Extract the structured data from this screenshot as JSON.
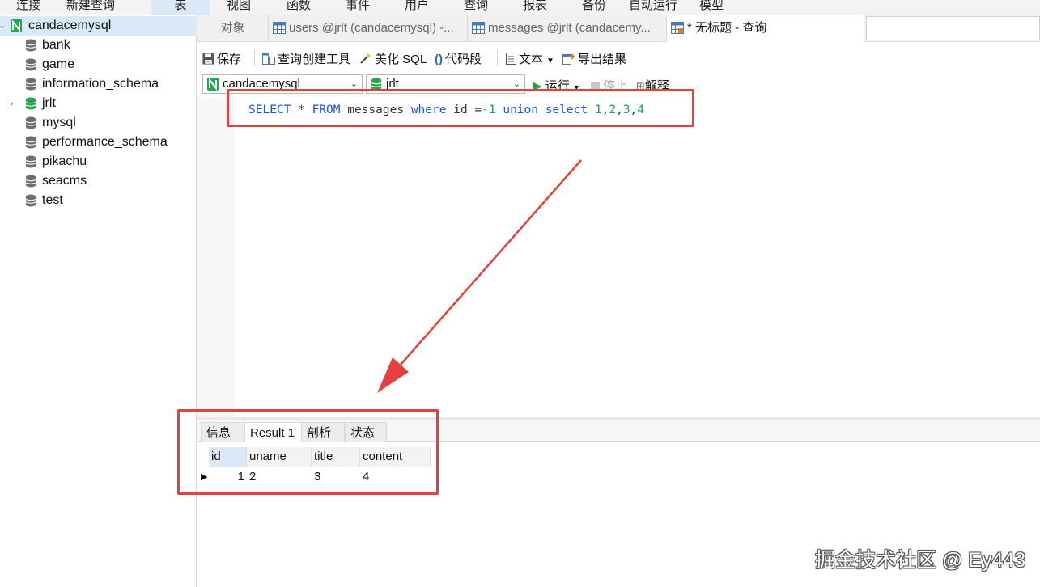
{
  "menu": [
    "连接",
    "新建查询",
    "表",
    "视图",
    "函数",
    "事件",
    "用户",
    "查询",
    "报表",
    "备份",
    "自动运行",
    "模型"
  ],
  "sidebar": {
    "connection": "candacemysql",
    "databases": [
      "bank",
      "game",
      "information_schema",
      "jrlt",
      "mysql",
      "performance_schema",
      "pikachu",
      "seacms",
      "test"
    ]
  },
  "tabs": {
    "objects": "对象",
    "tab1": "users @jrlt (candacemysql) -...",
    "tab2": "messages @jrlt (candacemy...",
    "tab3": "* 无标题 - 查询"
  },
  "toolbar": {
    "save": "保存",
    "query_builder": "查询创建工具",
    "beautify": "美化 SQL",
    "snippet": "代码段",
    "text": "文本",
    "export": "导出结果"
  },
  "selectors": {
    "connection": "candacemysql",
    "database": "jrlt",
    "run": "运行",
    "stop": "停止",
    "explain": "解释"
  },
  "editor": {
    "sql_tokens": [
      {
        "t": "SELECT",
        "c": "kw"
      },
      {
        "t": " * ",
        "c": "plain"
      },
      {
        "t": "FROM",
        "c": "kw"
      },
      {
        "t": " messages ",
        "c": "plain"
      },
      {
        "t": "where",
        "c": "kw"
      },
      {
        "t": " id =",
        "c": "plain"
      },
      {
        "t": "-1",
        "c": "num"
      },
      {
        "t": " ",
        "c": "plain"
      },
      {
        "t": "union",
        "c": "kw"
      },
      {
        "t": " ",
        "c": "plain"
      },
      {
        "t": "select",
        "c": "kw"
      },
      {
        "t": " ",
        "c": "plain"
      },
      {
        "t": "1",
        "c": "num"
      },
      {
        "t": ",",
        "c": "plain"
      },
      {
        "t": "2",
        "c": "num"
      },
      {
        "t": ",",
        "c": "plain"
      },
      {
        "t": "3",
        "c": "num"
      },
      {
        "t": ",",
        "c": "plain"
      },
      {
        "t": "4",
        "c": "num"
      }
    ]
  },
  "results": {
    "tabs": [
      "信息",
      "Result 1",
      "剖析",
      "状态"
    ],
    "columns": [
      "id",
      "uname",
      "title",
      "content"
    ],
    "rows": [
      [
        "1",
        "2",
        "3",
        "4"
      ]
    ]
  },
  "watermark": "掘金技术社区 @ Ey443",
  "colors": {
    "annotation": "#e34040",
    "keyword": "#1a4ff5",
    "number": "#1aa15a",
    "db_icon_green": "#1fa84f",
    "db_icon_gray": "#6f6f6f"
  }
}
